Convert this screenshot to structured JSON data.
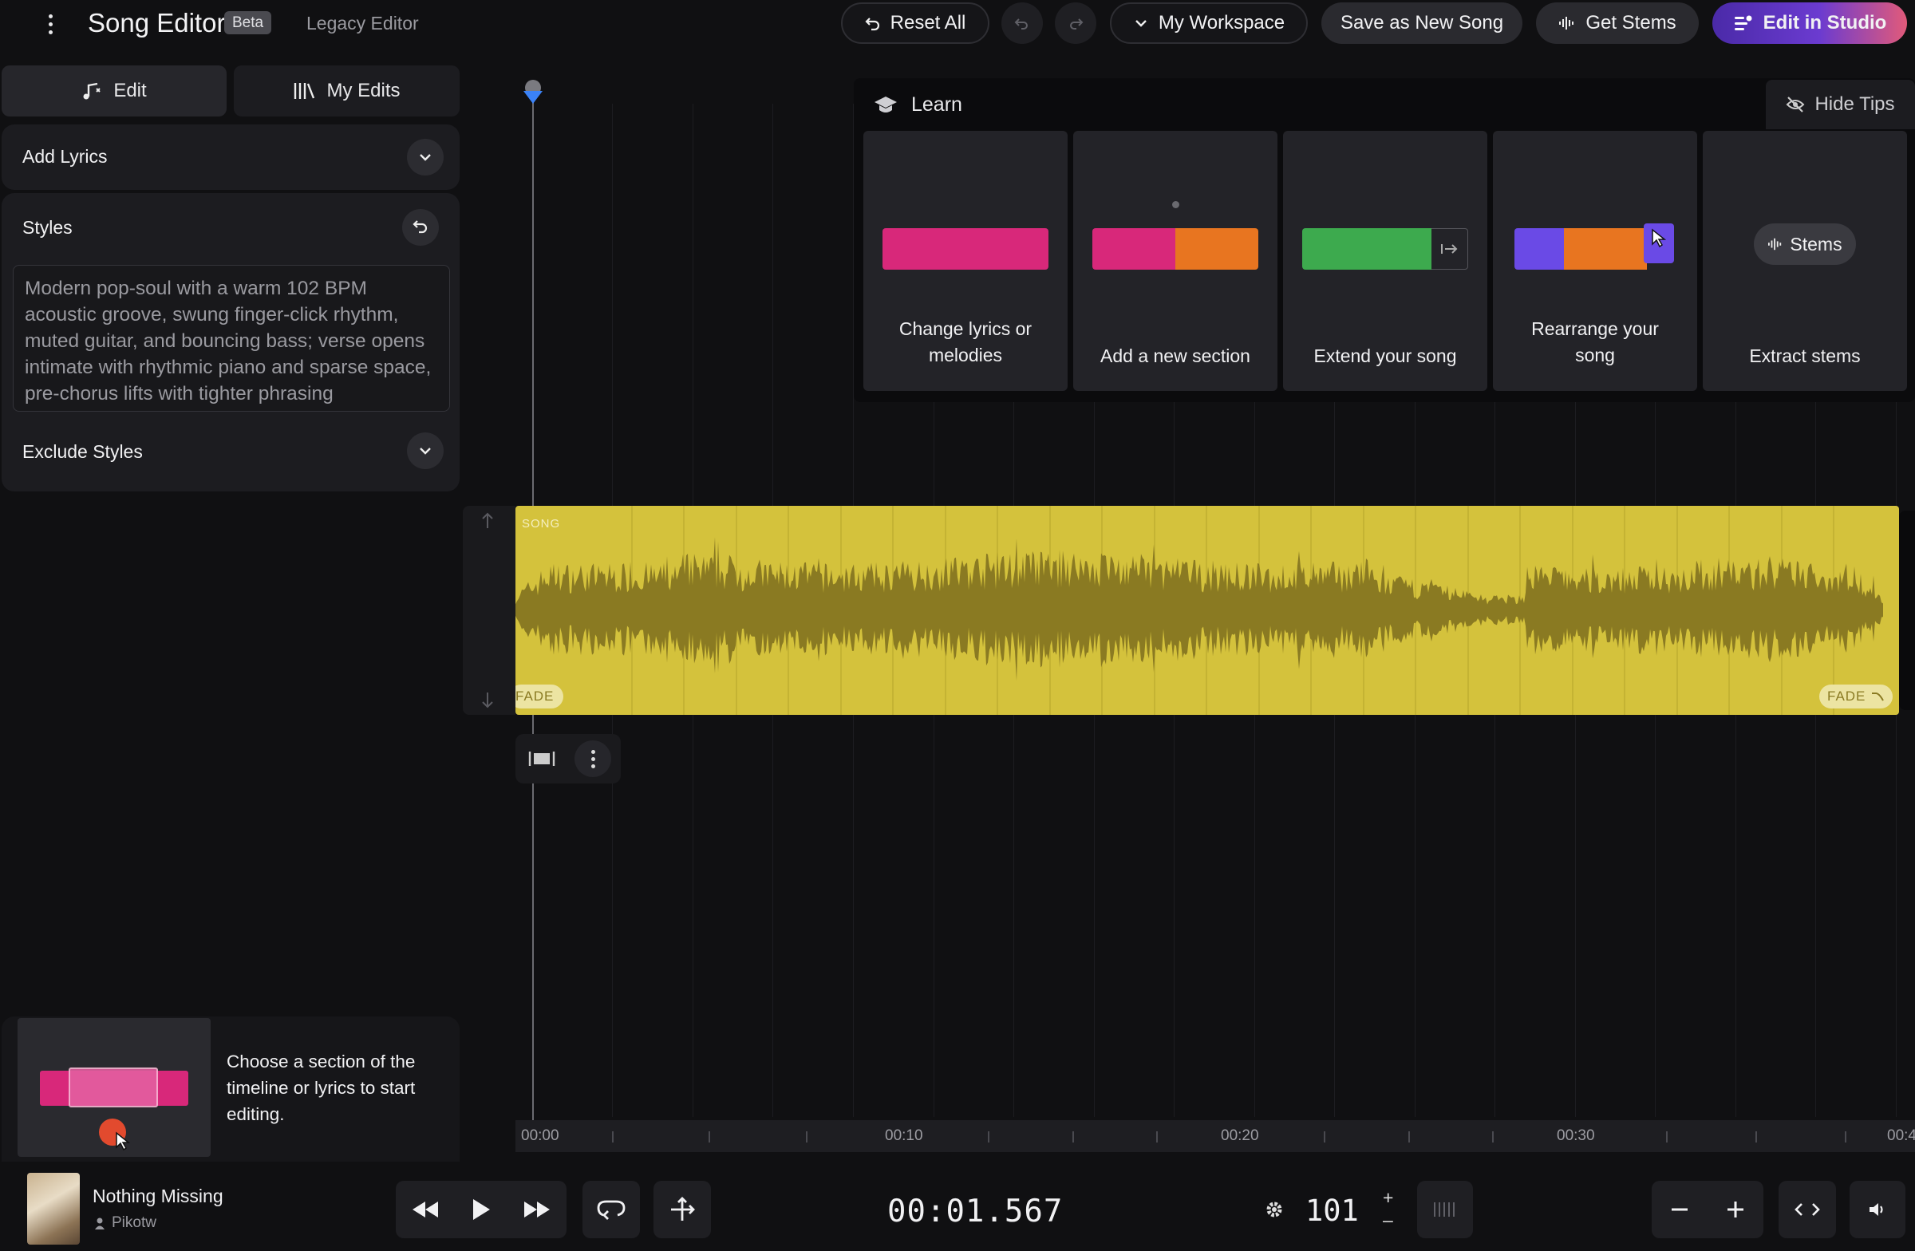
{
  "topbar": {
    "title": "Song Editor",
    "badge": "Beta",
    "legacy": "Legacy Editor",
    "reset": "Reset All",
    "workspace": "My Workspace",
    "save_new": "Save as New Song",
    "get_stems": "Get Stems",
    "edit_studio": "Edit in Studio"
  },
  "sidebar": {
    "tabs": {
      "edit": "Edit",
      "my_edits": "My Edits"
    },
    "add_lyrics": "Add Lyrics",
    "styles_label": "Styles",
    "styles_text": "Modern pop-soul with a warm 102 BPM acoustic groove, swung finger-click rhythm, muted guitar, and bouncing bass; verse opens intimate with rhythmic piano and sparse space, pre-chorus lifts with tighter phrasing",
    "exclude_styles": "Exclude Styles",
    "hint": "Choose a section of the timeline or lyrics to start editing."
  },
  "learn": {
    "title": "Learn",
    "hide_tips": "Hide Tips",
    "tips": [
      {
        "label": "Change lyrics or melodies"
      },
      {
        "label": "Add a new section"
      },
      {
        "label": "Extend your song"
      },
      {
        "label": "Rearrange your song"
      },
      {
        "label": "Extract stems",
        "chip": "Stems"
      }
    ]
  },
  "track": {
    "label": "SONG",
    "fade_in": "FADE",
    "fade_out": "FADE"
  },
  "ruler": {
    "labels": [
      "00:00",
      "00:10",
      "00:20",
      "00:30",
      "00:4"
    ]
  },
  "player": {
    "song_title": "Nothing Missing",
    "artist": "Pikotw",
    "time": "00:01.567",
    "bpm": "101",
    "plus": "+",
    "minus": "–"
  },
  "colors": {
    "track": "#d4c23c",
    "waveform": "#8a7a22",
    "playhead": "#3b82f6",
    "tip_pink": "#d8287a",
    "tip_orange": "#e87520",
    "tip_green": "#3daa4e",
    "tip_purple": "#6a4ae6"
  }
}
